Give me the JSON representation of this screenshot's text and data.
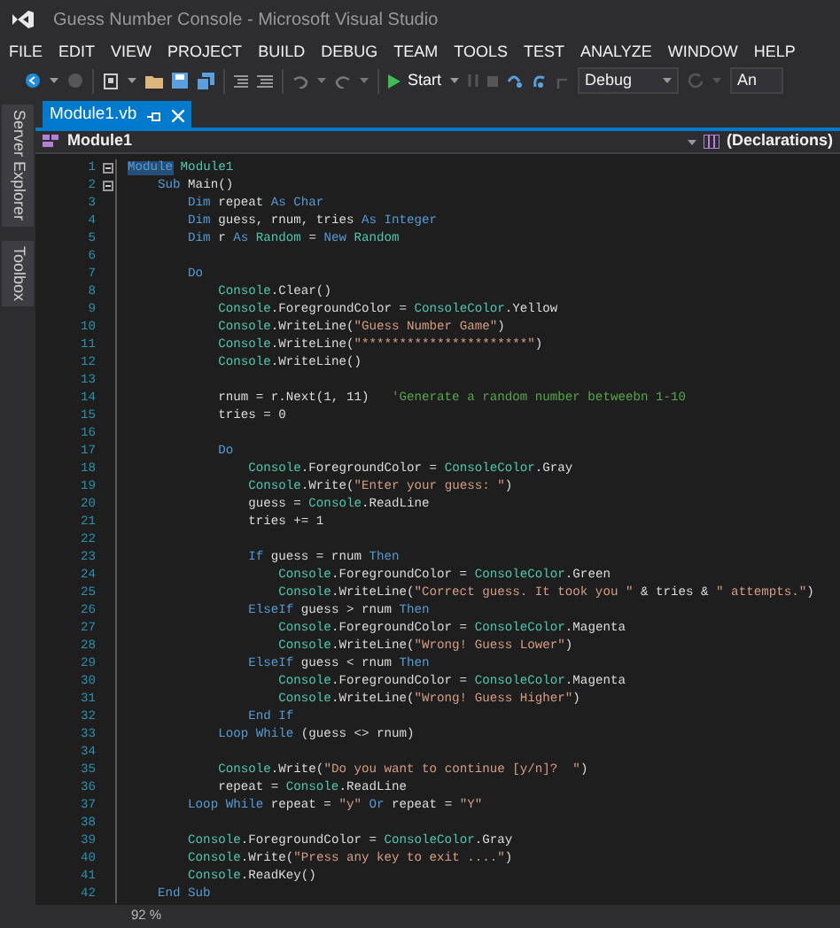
{
  "window": {
    "title": "Guess Number Console - Microsoft Visual Studio"
  },
  "menu": [
    "FILE",
    "EDIT",
    "VIEW",
    "PROJECT",
    "BUILD",
    "DEBUG",
    "TEAM",
    "TOOLS",
    "TEST",
    "ANALYZE",
    "WINDOW",
    "HELP"
  ],
  "toolbar": {
    "start_label": "Start",
    "configuration": "Debug",
    "platform": "An"
  },
  "side_tabs": [
    "Server Explorer",
    "Toolbox"
  ],
  "document_tab": {
    "label": "Module1.vb",
    "selected": true
  },
  "navigation": {
    "type_dropdown": "Module1",
    "member_dropdown": "(Declarations)"
  },
  "code_lines": [
    {
      "n": "1",
      "fold": true,
      "tokens": [
        {
          "kind": "selected",
          "text": "Module"
        },
        {
          "kind": "type",
          "text": " Module1"
        }
      ]
    },
    {
      "n": "2",
      "fold": true,
      "tokens": [
        {
          "kind": "keyword",
          "text": "    Sub"
        },
        {
          "kind": "plain",
          "text": " Main()"
        }
      ]
    },
    {
      "n": "3",
      "fold": false,
      "tokens": [
        {
          "kind": "keyword",
          "text": "        Dim"
        },
        {
          "kind": "plain",
          "text": " repeat "
        },
        {
          "kind": "keyword",
          "text": "As Char"
        }
      ]
    },
    {
      "n": "4",
      "fold": false,
      "tokens": [
        {
          "kind": "keyword",
          "text": "        Dim"
        },
        {
          "kind": "plain",
          "text": " guess, rnum, tries "
        },
        {
          "kind": "keyword",
          "text": "As Integer"
        }
      ]
    },
    {
      "n": "5",
      "fold": false,
      "tokens": [
        {
          "kind": "keyword",
          "text": "        Dim"
        },
        {
          "kind": "plain",
          "text": " r "
        },
        {
          "kind": "keyword",
          "text": "As"
        },
        {
          "kind": "type",
          "text": " Random"
        },
        {
          "kind": "plain",
          "text": " = "
        },
        {
          "kind": "keyword",
          "text": "New"
        },
        {
          "kind": "type",
          "text": " Random"
        }
      ]
    },
    {
      "n": "6",
      "fold": false
    },
    {
      "n": "7",
      "fold": false,
      "tokens": [
        {
          "kind": "keyword",
          "text": "        Do"
        }
      ]
    },
    {
      "n": "8",
      "fold": false,
      "tokens": [
        {
          "kind": "type",
          "text": "            Console"
        },
        {
          "kind": "plain",
          "text": ".Clear()"
        }
      ]
    },
    {
      "n": "9",
      "fold": false,
      "tokens": [
        {
          "kind": "type",
          "text": "            Console"
        },
        {
          "kind": "plain",
          "text": ".ForegroundColor = "
        },
        {
          "kind": "type",
          "text": "ConsoleColor"
        },
        {
          "kind": "plain",
          "text": ".Yellow"
        }
      ]
    },
    {
      "n": "10",
      "fold": false,
      "tokens": [
        {
          "kind": "type",
          "text": "            Console"
        },
        {
          "kind": "plain",
          "text": ".WriteLine("
        },
        {
          "kind": "string",
          "text": "\"Guess Number Game\""
        },
        {
          "kind": "plain",
          "text": ")"
        }
      ]
    },
    {
      "n": "11",
      "fold": false,
      "tokens": [
        {
          "kind": "type",
          "text": "            Console"
        },
        {
          "kind": "plain",
          "text": ".WriteLine("
        },
        {
          "kind": "string",
          "text": "\"**********************\""
        },
        {
          "kind": "plain",
          "text": ")"
        }
      ]
    },
    {
      "n": "12",
      "fold": false,
      "tokens": [
        {
          "kind": "type",
          "text": "            Console"
        },
        {
          "kind": "plain",
          "text": ".WriteLine()"
        }
      ]
    },
    {
      "n": "13",
      "fold": false
    },
    {
      "n": "14",
      "fold": false,
      "tokens": [
        {
          "kind": "plain",
          "text": "            rnum = r.Next(1, 11)   "
        },
        {
          "kind": "comment",
          "text": "'Generate a random number betweebn 1-10"
        }
      ]
    },
    {
      "n": "15",
      "fold": false,
      "tokens": [
        {
          "kind": "plain",
          "text": "            tries = 0"
        }
      ]
    },
    {
      "n": "16",
      "fold": false
    },
    {
      "n": "17",
      "fold": false,
      "tokens": [
        {
          "kind": "keyword",
          "text": "            Do"
        }
      ]
    },
    {
      "n": "18",
      "fold": false,
      "tokens": [
        {
          "kind": "type",
          "text": "                Console"
        },
        {
          "kind": "plain",
          "text": ".ForegroundColor = "
        },
        {
          "kind": "type",
          "text": "ConsoleColor"
        },
        {
          "kind": "plain",
          "text": ".Gray"
        }
      ]
    },
    {
      "n": "19",
      "fold": false,
      "tokens": [
        {
          "kind": "type",
          "text": "                Console"
        },
        {
          "kind": "plain",
          "text": ".Write("
        },
        {
          "kind": "string",
          "text": "\"Enter your guess: \""
        },
        {
          "kind": "plain",
          "text": ")"
        }
      ]
    },
    {
      "n": "20",
      "fold": false,
      "tokens": [
        {
          "kind": "plain",
          "text": "                guess = "
        },
        {
          "kind": "type",
          "text": "Console"
        },
        {
          "kind": "plain",
          "text": ".ReadLine"
        }
      ]
    },
    {
      "n": "21",
      "fold": false,
      "tokens": [
        {
          "kind": "plain",
          "text": "                tries += 1"
        }
      ]
    },
    {
      "n": "22",
      "fold": false
    },
    {
      "n": "23",
      "fold": false,
      "tokens": [
        {
          "kind": "keyword",
          "text": "                If"
        },
        {
          "kind": "plain",
          "text": " guess = rnum "
        },
        {
          "kind": "keyword",
          "text": "Then"
        }
      ]
    },
    {
      "n": "24",
      "fold": false,
      "tokens": [
        {
          "kind": "type",
          "text": "                    Console"
        },
        {
          "kind": "plain",
          "text": ".ForegroundColor = "
        },
        {
          "kind": "type",
          "text": "ConsoleColor"
        },
        {
          "kind": "plain",
          "text": ".Green"
        }
      ]
    },
    {
      "n": "25",
      "fold": false,
      "tokens": [
        {
          "kind": "type",
          "text": "                    Console"
        },
        {
          "kind": "plain",
          "text": ".WriteLine("
        },
        {
          "kind": "string",
          "text": "\"Correct guess. It took you \""
        },
        {
          "kind": "plain",
          "text": " & tries & "
        },
        {
          "kind": "string",
          "text": "\" attempts.\""
        },
        {
          "kind": "plain",
          "text": ")"
        }
      ]
    },
    {
      "n": "26",
      "fold": false,
      "tokens": [
        {
          "kind": "keyword",
          "text": "                ElseIf"
        },
        {
          "kind": "plain",
          "text": " guess > rnum "
        },
        {
          "kind": "keyword",
          "text": "Then"
        }
      ]
    },
    {
      "n": "27",
      "fold": false,
      "tokens": [
        {
          "kind": "type",
          "text": "                    Console"
        },
        {
          "kind": "plain",
          "text": ".ForegroundColor = "
        },
        {
          "kind": "type",
          "text": "ConsoleColor"
        },
        {
          "kind": "plain",
          "text": ".Magenta"
        }
      ]
    },
    {
      "n": "28",
      "fold": false,
      "tokens": [
        {
          "kind": "type",
          "text": "                    Console"
        },
        {
          "kind": "plain",
          "text": ".WriteLine("
        },
        {
          "kind": "string",
          "text": "\"Wrong! Guess Lower\""
        },
        {
          "kind": "plain",
          "text": ")"
        }
      ]
    },
    {
      "n": "29",
      "fold": false,
      "tokens": [
        {
          "kind": "keyword",
          "text": "                ElseIf"
        },
        {
          "kind": "plain",
          "text": " guess < rnum "
        },
        {
          "kind": "keyword",
          "text": "Then"
        }
      ]
    },
    {
      "n": "30",
      "fold": false,
      "tokens": [
        {
          "kind": "type",
          "text": "                    Console"
        },
        {
          "kind": "plain",
          "text": ".ForegroundColor = "
        },
        {
          "kind": "type",
          "text": "ConsoleColor"
        },
        {
          "kind": "plain",
          "text": ".Magenta"
        }
      ]
    },
    {
      "n": "31",
      "fold": false,
      "tokens": [
        {
          "kind": "type",
          "text": "                    Console"
        },
        {
          "kind": "plain",
          "text": ".WriteLine("
        },
        {
          "kind": "string",
          "text": "\"Wrong! Guess Higher\""
        },
        {
          "kind": "plain",
          "text": ")"
        }
      ]
    },
    {
      "n": "32",
      "fold": false,
      "tokens": [
        {
          "kind": "keyword",
          "text": "                End If"
        }
      ]
    },
    {
      "n": "33",
      "fold": false,
      "tokens": [
        {
          "kind": "keyword",
          "text": "            Loop While"
        },
        {
          "kind": "plain",
          "text": " (guess <> rnum)"
        }
      ]
    },
    {
      "n": "34",
      "fold": false
    },
    {
      "n": "35",
      "fold": false,
      "tokens": [
        {
          "kind": "type",
          "text": "            Console"
        },
        {
          "kind": "plain",
          "text": ".Write("
        },
        {
          "kind": "string",
          "text": "\"Do you want to continue [y/n]?  \""
        },
        {
          "kind": "plain",
          "text": ")"
        }
      ]
    },
    {
      "n": "36",
      "fold": false,
      "tokens": [
        {
          "kind": "plain",
          "text": "            repeat = "
        },
        {
          "kind": "type",
          "text": "Console"
        },
        {
          "kind": "plain",
          "text": ".ReadLine"
        }
      ]
    },
    {
      "n": "37",
      "fold": false,
      "tokens": [
        {
          "kind": "keyword",
          "text": "        Loop While"
        },
        {
          "kind": "plain",
          "text": " repeat = "
        },
        {
          "kind": "string",
          "text": "\"y\""
        },
        {
          "kind": "keyword",
          "text": " Or"
        },
        {
          "kind": "plain",
          "text": " repeat = "
        },
        {
          "kind": "string",
          "text": "\"Y\""
        }
      ]
    },
    {
      "n": "38",
      "fold": false
    },
    {
      "n": "39",
      "fold": false,
      "tokens": [
        {
          "kind": "type",
          "text": "        Console"
        },
        {
          "kind": "plain",
          "text": ".ForegroundColor = "
        },
        {
          "kind": "type",
          "text": "ConsoleColor"
        },
        {
          "kind": "plain",
          "text": ".Gray"
        }
      ]
    },
    {
      "n": "40",
      "fold": false,
      "tokens": [
        {
          "kind": "type",
          "text": "        Console"
        },
        {
          "kind": "plain",
          "text": ".Write("
        },
        {
          "kind": "string",
          "text": "\"Press any key to exit ....\""
        },
        {
          "kind": "plain",
          "text": ")"
        }
      ]
    },
    {
      "n": "41",
      "fold": false,
      "tokens": [
        {
          "kind": "type",
          "text": "        Console"
        },
        {
          "kind": "plain",
          "text": ".ReadKey()"
        }
      ]
    },
    {
      "n": "42",
      "fold": false,
      "tokens": [
        {
          "kind": "keyword",
          "text": "    End Sub"
        }
      ]
    }
  ],
  "status": {
    "zoom": "92 %"
  }
}
